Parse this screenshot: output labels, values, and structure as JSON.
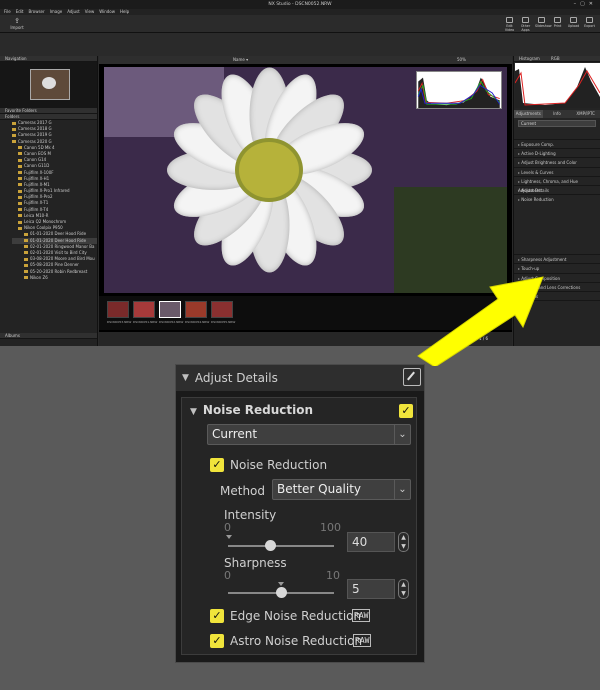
{
  "app": {
    "title": "NX Studio  -  DSCN0052.NRW",
    "menu": [
      "File",
      "Edit",
      "Browser",
      "Image",
      "Adjust",
      "View",
      "Window",
      "Help"
    ],
    "import": "Import",
    "toolbar_buttons": [
      "Edit Video",
      "Other Apps",
      "Slideshow",
      "Print",
      "Upload",
      "Export"
    ]
  },
  "left_panel": {
    "navigation": "Navigation",
    "favorites": "Favorite Folders",
    "folders": "Folders",
    "albums": "Albums",
    "folder_items": [
      "Cameras 2017 G",
      "Cameras 2018 G",
      "Cameras 2019 G",
      "Cameras 2020 G",
      "Canon 5D Mk 4",
      "Canon EOS M",
      "Canon G14",
      "Canon G11D",
      "Fujifilm X-100F",
      "Fujifilm X-H1",
      "Fujifilm X-M1",
      "Fujifilm X-Pro1 Infrared",
      "Fujifilm X-Pro2",
      "Fujifilm X-T1",
      "Fujifilm X-T4",
      "Leica M10-R",
      "Leica Q2 Monochrom",
      "Nikon Coolpix P950",
      "01-01-2020 Deer Hood Ride",
      "01-01-2020 Deer Hood Ride",
      "02-01-2020 Ringwood Manor Ba",
      "02-01-2020 Visit to Bird City",
      "03-08-2020 Moore and Bird Mou",
      "05-08-2020 Pine Denner",
      "05-20-2020 Robin Redbreast",
      "Nikon Z6"
    ]
  },
  "viewer": {
    "zoom": "50%",
    "sort": "Name",
    "filmstrip": [
      "DSCN0053.NRW",
      "DSCN0051.NRW",
      "DSCN0052.NRW",
      "DSCN0054.NRW",
      "DSCN0055.NRW"
    ],
    "page": "1 / 6"
  },
  "right_panel": {
    "histogram": "Histogram",
    "histo_channel": "RGB",
    "tabs": [
      "Adjustments",
      "Info",
      "XMP/IPTC"
    ],
    "preset": "Current",
    "sections": [
      "Exposure Comp.",
      "Active D-Lighting",
      "Adjust Brightness and Color",
      "Levels & Curves",
      "Lightness, Chroma, and Hue Adjustment",
      "Adjust Details",
      "Noise Reduction",
      "Sharpness Adjustment",
      "Touch-up",
      "Adjust Composition",
      "Camera and Lens Corrections",
      "Versions"
    ]
  },
  "panel": {
    "title": "Adjust Details",
    "noise_reduction_heading": "Noise Reduction",
    "preset": "Current",
    "nr_checkbox_label": "Noise Reduction",
    "method_label": "Method",
    "method_value": "Better Quality",
    "intensity": {
      "label": "Intensity",
      "min": "0",
      "max": "100",
      "value": "40"
    },
    "sharpness": {
      "label": "Sharpness",
      "min": "0",
      "max": "10",
      "value": "5"
    },
    "edge_nr_label": "Edge Noise Reduction",
    "astro_nr_label": "Astro Noise Reduction",
    "raw_badge": "RAW",
    "checked": "✓"
  },
  "colors": {
    "accent_yellow": "#f0e43b",
    "arrow_yellow": "#ffff00",
    "panel_bg": "#1a1a1a"
  }
}
